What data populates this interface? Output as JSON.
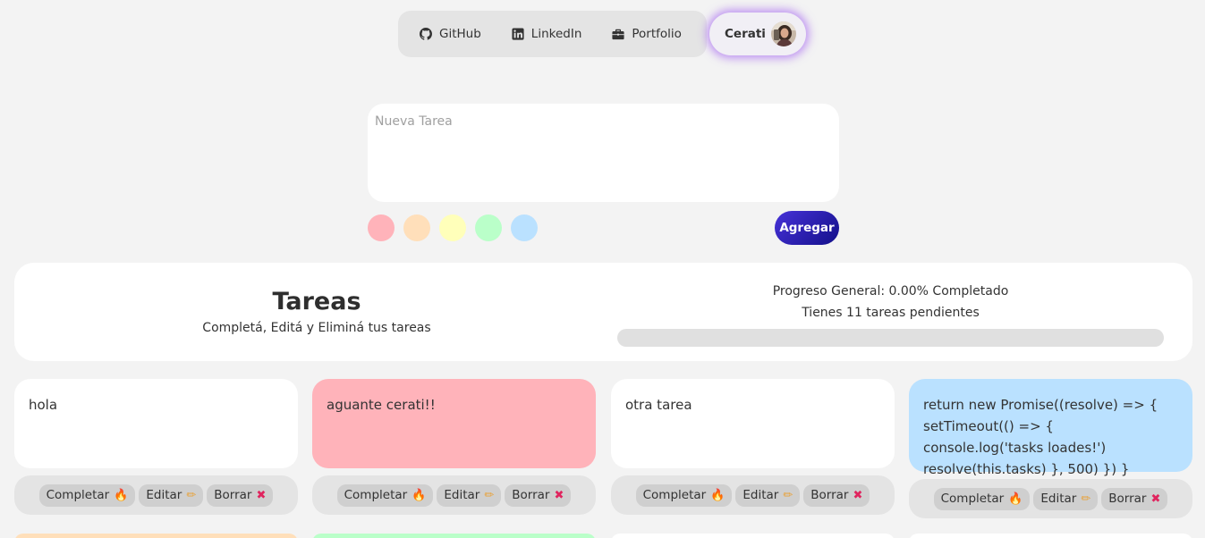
{
  "nav": {
    "links": [
      {
        "label": "GitHub",
        "icon": "github-icon"
      },
      {
        "label": "LinkedIn",
        "icon": "linkedin-icon"
      },
      {
        "label": "Portfolio",
        "icon": "briefcase-icon"
      }
    ],
    "profile_name": "Cerati"
  },
  "new_task": {
    "placeholder": "Nueva Tarea",
    "value": "",
    "colors": [
      "#ffb3ba",
      "#ffdfba",
      "#ffffba",
      "#baffc9",
      "#bae1ff"
    ],
    "add_label": "Agregar"
  },
  "header": {
    "title": "Tareas",
    "subtitle": "Completá, Editá y Eliminá tus tareas",
    "progress_text": "Progreso General: 0.00% Completado",
    "pending_text": "Tienes 11 tareas pendientes",
    "progress_fraction": 0
  },
  "actions": {
    "complete_label": "Completar",
    "edit_label": "Editar",
    "delete_label": "Borrar",
    "complete_emoji": "🔥",
    "edit_emoji": "✏",
    "delete_emoji": "✖"
  },
  "tasks": [
    {
      "text": "hola",
      "color": "#ffffff"
    },
    {
      "text": "aguante cerati!!",
      "color": "#ffb3ba"
    },
    {
      "text": "otra tarea",
      "color": "#ffffff"
    },
    {
      "text": "return new Promise((resolve) => { setTimeout(() => { console.log('tasks loades!') resolve(this.tasks) }, 500) }) }",
      "color": "#bae1ff"
    }
  ],
  "next_row_colors": [
    "#ffdfba",
    "#baffc9",
    "#ffffff",
    "#ffffff"
  ]
}
